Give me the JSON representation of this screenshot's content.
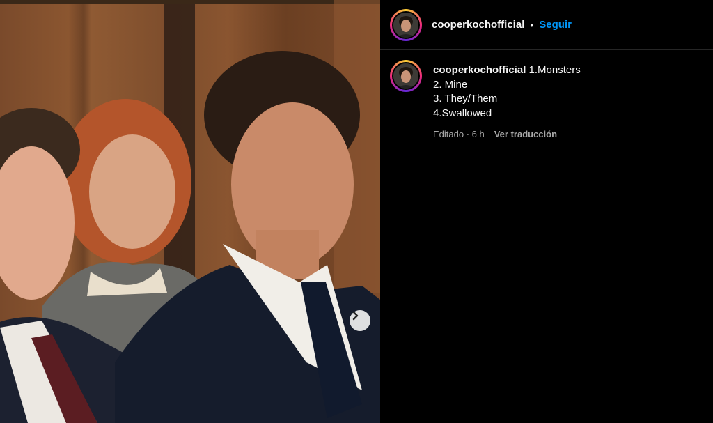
{
  "post": {
    "username": "cooperkochofficial",
    "separator": "•",
    "follow_label": "Seguir",
    "caption": {
      "username": "cooperkochofficial",
      "lines": [
        "1.Monsters",
        "2. Mine",
        "3. They/Them",
        "4.Swallowed"
      ]
    },
    "meta": {
      "edited_time": "Editado · 6 h",
      "translate_label": "Ver traducción"
    }
  },
  "icons": {
    "next": "chevron-right-icon"
  },
  "colors": {
    "accent": "#0095f6",
    "background": "#000000",
    "muted_text": "#a8a8a8"
  }
}
